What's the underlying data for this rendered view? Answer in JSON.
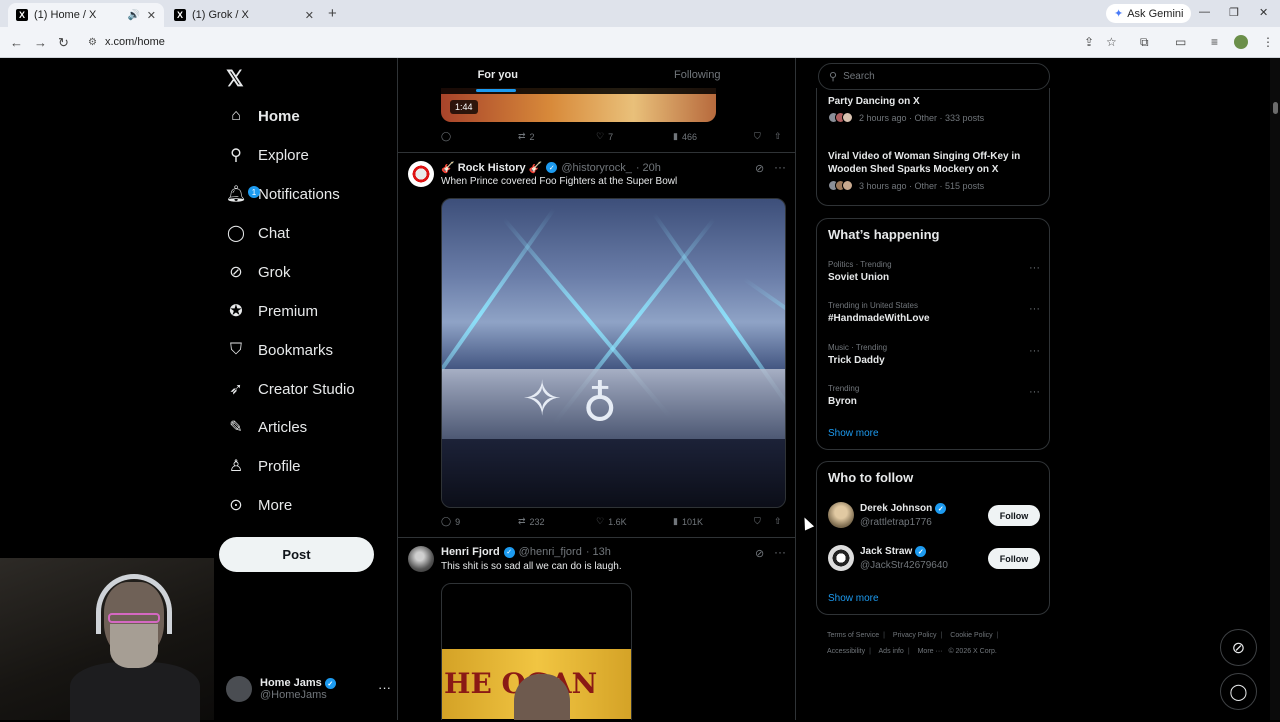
{
  "browser": {
    "tabs": [
      {
        "title": "(1) Home / X"
      },
      {
        "title": "(1) Grok / X"
      }
    ],
    "ask_gemini": "Ask Gemini",
    "url": "x.com/home"
  },
  "nav": {
    "items": [
      {
        "label": "Home",
        "icon": "home-icon"
      },
      {
        "label": "Explore",
        "icon": "search-icon"
      },
      {
        "label": "Notifications",
        "icon": "bell-icon",
        "badge": "1"
      },
      {
        "label": "Chat",
        "icon": "chat-icon"
      },
      {
        "label": "Grok",
        "icon": "grok-icon"
      },
      {
        "label": "Premium",
        "icon": "premium-icon"
      },
      {
        "label": "Bookmarks",
        "icon": "bookmark-icon"
      },
      {
        "label": "Creator Studio",
        "icon": "rocket-icon"
      },
      {
        "label": "Articles",
        "icon": "articles-icon"
      },
      {
        "label": "Profile",
        "icon": "person-icon"
      },
      {
        "label": "More",
        "icon": "more-circle-icon"
      }
    ],
    "post_label": "Post",
    "account": {
      "name": "Home Jams",
      "handle": "@HomeJams"
    }
  },
  "timeline": {
    "tabs": [
      "For you",
      "Following"
    ],
    "top_post": {
      "duration": "1:44",
      "replies": "",
      "reposts": "2",
      "likes": "7",
      "views": "466"
    },
    "posts": [
      {
        "name": "🎸 Rock History 🎸",
        "handle": "@historyrock_",
        "time": "· 20h",
        "text": "When Prince covered Foo Fighters at the Super Bowl",
        "replies": "9",
        "reposts": "232",
        "likes": "1.6K",
        "views": "101K"
      },
      {
        "name": "Henri Fjord",
        "handle": "@henri_fjord",
        "time": "· 13h",
        "text": "This shit is so sad all we can do is laugh.",
        "media_sign": "HE  OGAN"
      }
    ]
  },
  "right": {
    "search_placeholder": "Search",
    "stories": [
      {
        "title": "Party Dancing on X",
        "meta": "2 hours ago · Other · 333 posts"
      },
      {
        "title": "Viral Video of Woman Singing Off-Key in Wooden Shed Sparks Mockery on X",
        "meta": "3 hours ago · Other · 515 posts"
      }
    ],
    "happening_title": "What’s happening",
    "trends": [
      {
        "category": "Politics · Trending",
        "name": "Soviet Union"
      },
      {
        "category": "Trending in United States",
        "name": "#HandmadeWithLove"
      },
      {
        "category": "Music · Trending",
        "name": "Trick Daddy"
      },
      {
        "category": "Trending",
        "name": "Byron"
      }
    ],
    "show_more": "Show more",
    "who_title": "Who to follow",
    "who": [
      {
        "name": "Derek Johnson",
        "handle": "@rattletrap1776",
        "button": "Follow"
      },
      {
        "name": "Jack Straw",
        "handle": "@JackStr42679640",
        "button": "Follow"
      }
    ],
    "footer": [
      "Terms of Service",
      "Privacy Policy",
      "Cookie Policy",
      "Accessibility",
      "Ads info",
      "More ···",
      "© 2026 X Corp."
    ]
  },
  "colors": {
    "accent": "#1d9bf0",
    "bg": "#000000",
    "border": "#2f3336",
    "muted": "#71767b"
  }
}
